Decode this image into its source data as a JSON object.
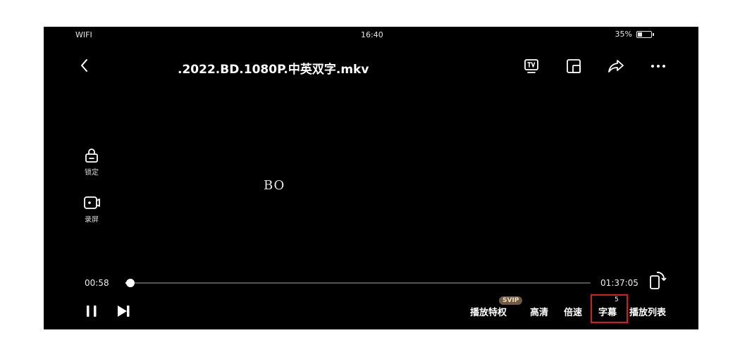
{
  "status_bar": {
    "network": "WIFI",
    "time": "16:40",
    "battery": "35%",
    "battery_level": 0.35
  },
  "header": {
    "title": ".2022.BD.1080P.中英双字.mkv"
  },
  "top_icons": [
    "tv-cast-icon",
    "picture-in-picture-icon",
    "share-icon",
    "more-icon"
  ],
  "side_controls": [
    {
      "icon": "lock-icon",
      "label": "锁定"
    },
    {
      "icon": "screen-record-icon",
      "label": "录屏"
    }
  ],
  "video": {
    "subtitle_text": "BO"
  },
  "progress": {
    "current": "00:58",
    "total": "01:37:05",
    "fraction": 0.01
  },
  "bottom_menu": {
    "privilege": "播放特权",
    "svip_badge": "SVIP",
    "quality": "高清",
    "speed": "倍速",
    "subtitle": "字幕",
    "subtitle_count": "5",
    "playlist": "播放列表"
  },
  "colors": {
    "highlight": "#d61c1c",
    "svip_bg": "#6e5a46"
  }
}
